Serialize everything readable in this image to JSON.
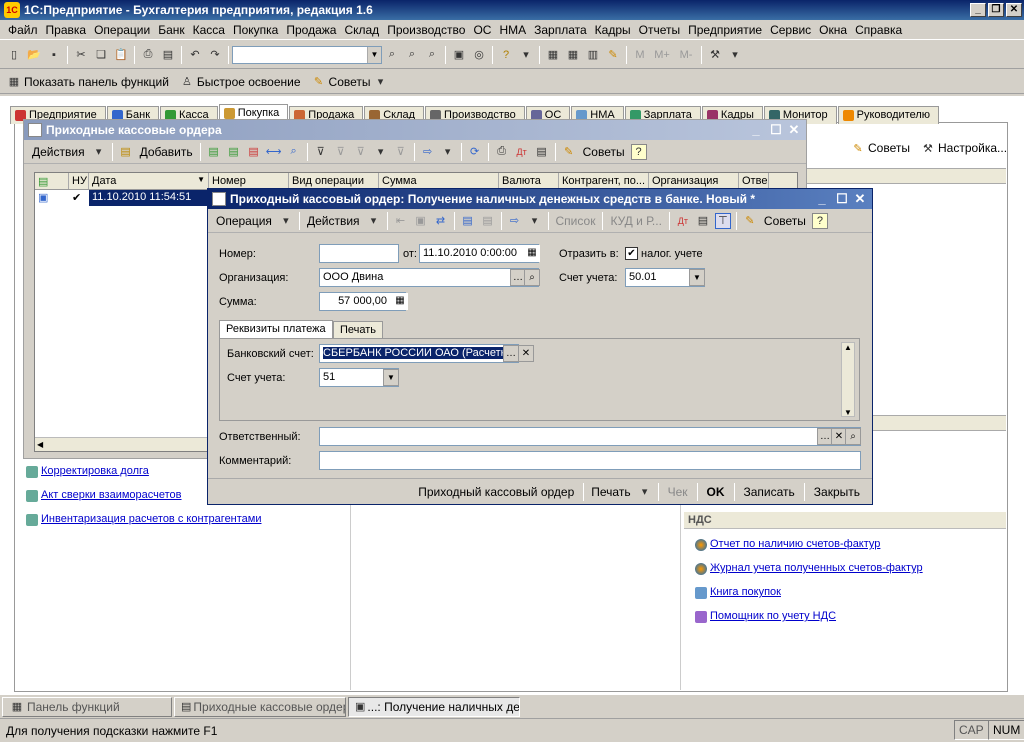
{
  "app": {
    "title": "1С:Предприятие - Бухгалтерия предприятия, редакция 1.6"
  },
  "menu": [
    "Файл",
    "Правка",
    "Операции",
    "Банк",
    "Касса",
    "Покупка",
    "Продажа",
    "Склад",
    "Производство",
    "ОС",
    "НМА",
    "Зарплата",
    "Кадры",
    "Отчеты",
    "Предприятие",
    "Сервис",
    "Окна",
    "Справка"
  ],
  "toolbar2": {
    "show_panel": "Показать панель функций",
    "quick_learn": "Быстрое освоение",
    "tips": "Советы"
  },
  "tabs": [
    {
      "label": "Предприятие"
    },
    {
      "label": "Банк"
    },
    {
      "label": "Касса"
    },
    {
      "label": "Покупка"
    },
    {
      "label": "Продажа"
    },
    {
      "label": "Склад"
    },
    {
      "label": "Производство"
    },
    {
      "label": "ОС"
    },
    {
      "label": "НМА"
    },
    {
      "label": "Зарплата"
    },
    {
      "label": "Кадры"
    },
    {
      "label": "Монитор"
    },
    {
      "label": "Руководителю"
    }
  ],
  "panel": {
    "right_tips": "Советы",
    "right_settings": "Настройка...",
    "links_left": [
      "Корректировка долга",
      "Акт сверки взаиморасчетов",
      "Инвентаризация расчетов с контрагентами"
    ],
    "nds_header": "НДС",
    "links_nds": [
      "Отчет по наличию счетов-фактур",
      "Журнал учета полученных счетов-фактур",
      "Книга покупок",
      "Помощник по учету НДС"
    ]
  },
  "list_window": {
    "title": "Приходные кассовые ордера",
    "actions": "Действия",
    "add": "Добавить",
    "tips": "Советы",
    "columns": [
      "НУ",
      "Дата",
      "Номер",
      "Вид операции",
      "Сумма",
      "Валюта",
      "Контрагент, по...",
      "Организация",
      "Отве"
    ],
    "row": {
      "nu": "✔",
      "date": "11.10.2010 11:54:51"
    }
  },
  "form_window": {
    "title": "Приходный кассовый ордер: Получение наличных денежных средств в банке. Новый *",
    "toolbar": {
      "operation": "Операция",
      "actions": "Действия",
      "list": "Список",
      "kud": "КУД и Р...",
      "tips": "Советы"
    },
    "number_label": "Номер:",
    "number_value": "",
    "from_label": "от:",
    "date_value": "11.10.2010  0:00:00",
    "reflect_label": "Отразить в:",
    "tax_label": "налог. учете",
    "org_label": "Организация:",
    "org_value": "ООО Двина",
    "account_label": "Счет учета:",
    "account_value": "50.01",
    "sum_label": "Сумма:",
    "sum_value": "57 000,00",
    "tab_details": "Реквизиты платежа",
    "tab_print": "Печать",
    "bank_label": "Банковский счет:",
    "bank_value": "СБЕРБАНК РОССИИ ОАО (Расчетн",
    "acc2_label": "Счет учета:",
    "acc2_value": "51",
    "resp_label": "Ответственный:",
    "resp_value": "",
    "comment_label": "Комментарий:",
    "comment_value": "",
    "bottom": {
      "pko": "Приходный кассовый ордер",
      "print": "Печать",
      "check": "Чек",
      "ok": "OK",
      "save": "Записать",
      "close": "Закрыть"
    }
  },
  "taskbar": [
    "Панель функций",
    "Приходные кассовые ордера",
    "...: Получение наличных ден..."
  ],
  "status": {
    "hint": "Для получения подсказки нажмите F1",
    "cap": "CAP",
    "num": "NUM"
  }
}
